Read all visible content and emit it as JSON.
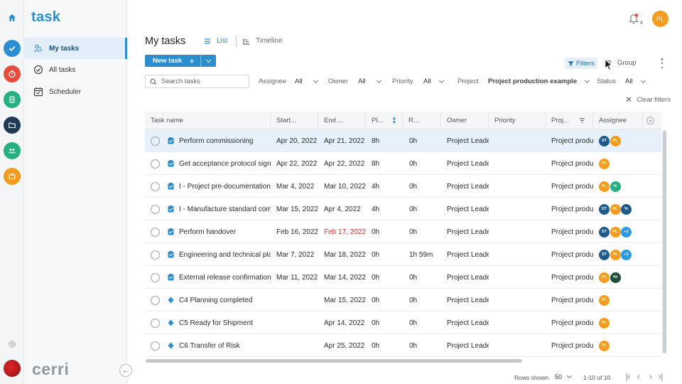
{
  "app": {
    "logo": "task",
    "brand": "cerri"
  },
  "sidebar": {
    "items": [
      {
        "label": "My tasks",
        "active": true
      },
      {
        "label": "All tasks",
        "active": false
      },
      {
        "label": "Scheduler",
        "active": false
      }
    ]
  },
  "topbar": {
    "notification_count": "4",
    "user_initials": "PL"
  },
  "header": {
    "title": "My tasks",
    "view_tabs": [
      {
        "label": "List",
        "active": true
      },
      {
        "label": "Timeline",
        "active": false
      }
    ],
    "new_task_label": "New task",
    "filters_label": "Filters",
    "group_label": "Group"
  },
  "filters": {
    "search_placeholder": "Search tasks",
    "assignee_label": "Assignee",
    "assignee_value": "All",
    "owner_label": "Owner",
    "owner_value": "All",
    "priority_label": "Priority",
    "priority_value": "All",
    "project_label": "Project",
    "project_value": "Project production example",
    "status_label": "Status",
    "status_value": "All",
    "clear_label": "Clear filters"
  },
  "table": {
    "columns": [
      "Task name",
      "Start...",
      "End ...",
      "Pl...",
      "R...",
      "Owner",
      "Priority",
      "Proj...",
      "Assignee"
    ],
    "rows": [
      {
        "type": "task",
        "name": "Perform commissioning",
        "start": "Apr 20, 2022",
        "end": "Apr 21, 2022",
        "end_late": false,
        "planned": "8h",
        "remaining": "0h",
        "owner": "Project Leader",
        "priority": "",
        "project": "Project production example",
        "assignees": [
          {
            "initials": "ST",
            "color": "#1f5a8c"
          },
          {
            "initials": "PL",
            "color": "#f39c1f"
          }
        ],
        "selected": true
      },
      {
        "type": "task",
        "name": "Get acceptance protocol signed",
        "start": "Apr 22, 2022",
        "end": "Apr 22, 2022",
        "end_late": false,
        "planned": "8h",
        "remaining": "0h",
        "owner": "Project Leader",
        "priority": "",
        "project": "Project production example",
        "assignees": [
          {
            "initials": "PL",
            "color": "#f39c1f"
          }
        ],
        "selected": false
      },
      {
        "type": "task",
        "name": "I - Project pre-documentation",
        "start": "Mar 4, 2022",
        "end": "Mar 10, 2022",
        "end_late": false,
        "planned": "4h",
        "remaining": "0h",
        "owner": "Project Leader",
        "priority": "",
        "project": "Project production example",
        "assignees": [
          {
            "initials": "PL",
            "color": "#f39c1f"
          },
          {
            "initials": "%",
            "color": "#26b07f"
          }
        ],
        "selected": false
      },
      {
        "type": "task",
        "name": "I - Manufacture standard components",
        "start": "Mar 15, 2022",
        "end": "Apr 4, 2022",
        "end_late": false,
        "planned": "4h",
        "remaining": "0h",
        "owner": "Project Leader",
        "priority": "",
        "project": "Project production example",
        "assignees": [
          {
            "initials": "ST",
            "color": "#1f5a8c"
          },
          {
            "initials": "PL",
            "color": "#f39c1f"
          },
          {
            "initials": "%",
            "color": "#1f5a8c"
          }
        ],
        "selected": false
      },
      {
        "type": "task",
        "name": "Perform handover",
        "start": "Feb 16, 2022",
        "end": "Feb 17, 2022",
        "end_late": true,
        "planned": "0h",
        "remaining": "0h",
        "owner": "Project Leader",
        "priority": "",
        "project": "Project production example",
        "assignees": [
          {
            "initials": "ST",
            "color": "#1f5a8c"
          },
          {
            "initials": "PL",
            "color": "#f39c1f"
          },
          {
            "initials": "+2",
            "color": "#2a9be0"
          }
        ],
        "selected": false
      },
      {
        "type": "task",
        "name": "Engineering and technical planning",
        "start": "Mar 7, 2022",
        "end": "Mar 18, 2022",
        "end_late": false,
        "planned": "0h",
        "remaining": "1h 59m",
        "owner": "Project Leader",
        "priority": "",
        "project": "Project production example",
        "assignees": [
          {
            "initials": "ST",
            "color": "#1f5a8c"
          },
          {
            "initials": "PL",
            "color": "#f39c1f"
          },
          {
            "initials": "+3",
            "color": "#2a9be0"
          }
        ],
        "selected": false
      },
      {
        "type": "task",
        "name": "External release confirmation",
        "start": "Mar 11, 2022",
        "end": "Mar 14, 2022",
        "end_late": false,
        "planned": "0h",
        "remaining": "0h",
        "owner": "Project Leader",
        "priority": "",
        "project": "Project production example",
        "assignees": [
          {
            "initials": "PL",
            "color": "#f39c1f"
          },
          {
            "initials": "%I",
            "color": "#1e4d3a"
          }
        ],
        "selected": false
      },
      {
        "type": "milestone",
        "name": "C4 Planning completed",
        "start": "",
        "end": "Mar 15, 2022",
        "end_late": false,
        "planned": "0h",
        "remaining": "0h",
        "owner": "Project Leader",
        "priority": "",
        "project": "Project production example",
        "assignees": [
          {
            "initials": "PL",
            "color": "#f39c1f"
          }
        ],
        "selected": false
      },
      {
        "type": "milestone",
        "name": "C5 Ready for Shipment",
        "start": "",
        "end": "Apr 14, 2022",
        "end_late": false,
        "planned": "0h",
        "remaining": "0h",
        "owner": "Project Leader",
        "priority": "",
        "project": "Project production example",
        "assignees": [
          {
            "initials": "PL",
            "color": "#f39c1f"
          }
        ],
        "selected": false
      },
      {
        "type": "milestone",
        "name": "C6 Transfer of Risk",
        "start": "",
        "end": "Apr 25, 2022",
        "end_late": false,
        "planned": "0h",
        "remaining": "0h",
        "owner": "Project Leader",
        "priority": "",
        "project": "Project production example",
        "assignees": [
          {
            "initials": "PL",
            "color": "#f39c1f"
          }
        ],
        "selected": false
      }
    ]
  },
  "pagination": {
    "rows_shown_label": "Rows shown",
    "page_size": "50",
    "range": "1-10 of 10"
  },
  "colors": {
    "accent": "#2a8fd1",
    "late": "#d0342c",
    "selected_row": "#e6f1fb",
    "rail_icons": [
      "#2a8fd1",
      "#e84c3d",
      "#26b07f",
      "#1f3a55",
      "#26b07f",
      "#f39c1f"
    ]
  }
}
